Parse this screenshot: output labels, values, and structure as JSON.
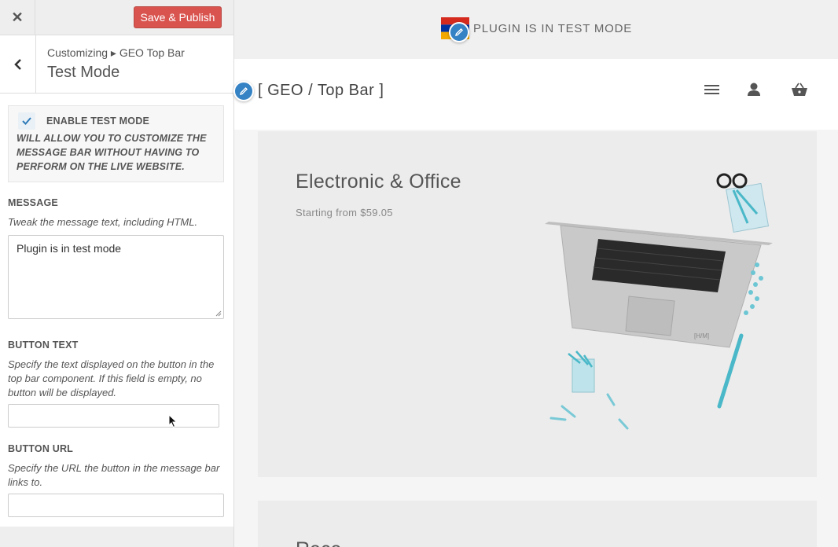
{
  "sidebar": {
    "close_label": "✕",
    "publish_label": "Save & Publish",
    "breadcrumb": "Customizing ▸ GEO Top Bar",
    "section_title": "Test Mode",
    "test_mode": {
      "checked": true,
      "label": "ENABLE TEST MODE",
      "description": "WILL ALLOW YOU TO CUSTOMIZE THE MESSAGE BAR WITHOUT HAVING TO PERFORM ON THE LIVE WEBSITE."
    },
    "message": {
      "label": "MESSAGE",
      "description": "Tweak the message text, including HTML.",
      "value": "Plugin is in test mode"
    },
    "button_text": {
      "label": "BUTTON TEXT",
      "description": "Specify the text displayed on the button in the top bar component. If this field is empty, no button will be displayed.",
      "value": ""
    },
    "button_url": {
      "label": "BUTTON URL",
      "description": "Specify the URL the button in the message bar links to.",
      "value": ""
    }
  },
  "preview": {
    "topbar_text": "PLUGIN IS IN TEST MODE",
    "site_title": "[ GEO / Top Bar ]",
    "hero_title": "Electronic & Office",
    "hero_subtitle": "Starting from $59.05",
    "next_card_title": "Rece",
    "icons": [
      "menu-icon",
      "user-icon",
      "basket-icon",
      "pencil-icon"
    ],
    "colors": {
      "publish": "#d9534f",
      "edit_bubble": "#3582c4",
      "flag_red": "#d52b1e",
      "flag_blue": "#0033a0",
      "flag_orange": "#f2a800"
    }
  }
}
